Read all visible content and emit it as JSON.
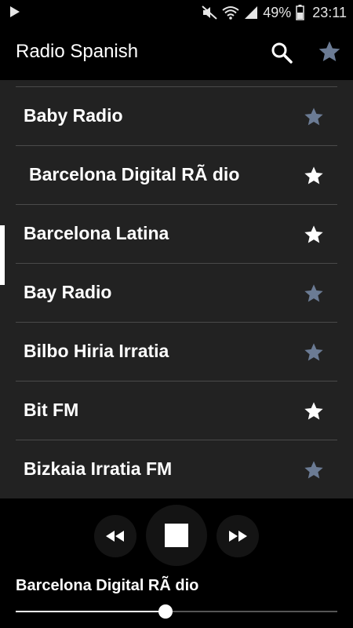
{
  "status_bar": {
    "battery": "49%",
    "time": "23:11",
    "icons": [
      "play-icon",
      "mute-icon",
      "wifi-icon",
      "signal-icon",
      "battery-icon"
    ]
  },
  "app_bar": {
    "title": "Radio Spanish",
    "search_icon": "search-icon",
    "favorites_icon": "star-icon"
  },
  "stations": [
    {
      "name": "Baby Radio",
      "favorite": false
    },
    {
      "name": " Barcelona Digital RÃ dio",
      "favorite": true,
      "selected": true
    },
    {
      "name": "Barcelona Latina",
      "favorite": true
    },
    {
      "name": "Bay Radio",
      "favorite": false
    },
    {
      "name": "Bilbo Hiria Irratia",
      "favorite": false
    },
    {
      "name": "Bit FM",
      "favorite": true
    },
    {
      "name": "Bizkaia Irratia FM",
      "favorite": false
    }
  ],
  "player": {
    "now_playing": "Barcelona Digital RÃ dio",
    "progress": 0.465,
    "controls": [
      "rewind-icon",
      "stop-icon",
      "fast-forward-icon"
    ]
  },
  "colors": {
    "background": "#000000",
    "list_background": "#222222",
    "divider": "#4a4a4a",
    "star_active": "#ffffff",
    "star_inactive": "#6b7b94",
    "text": "#ffffff"
  }
}
